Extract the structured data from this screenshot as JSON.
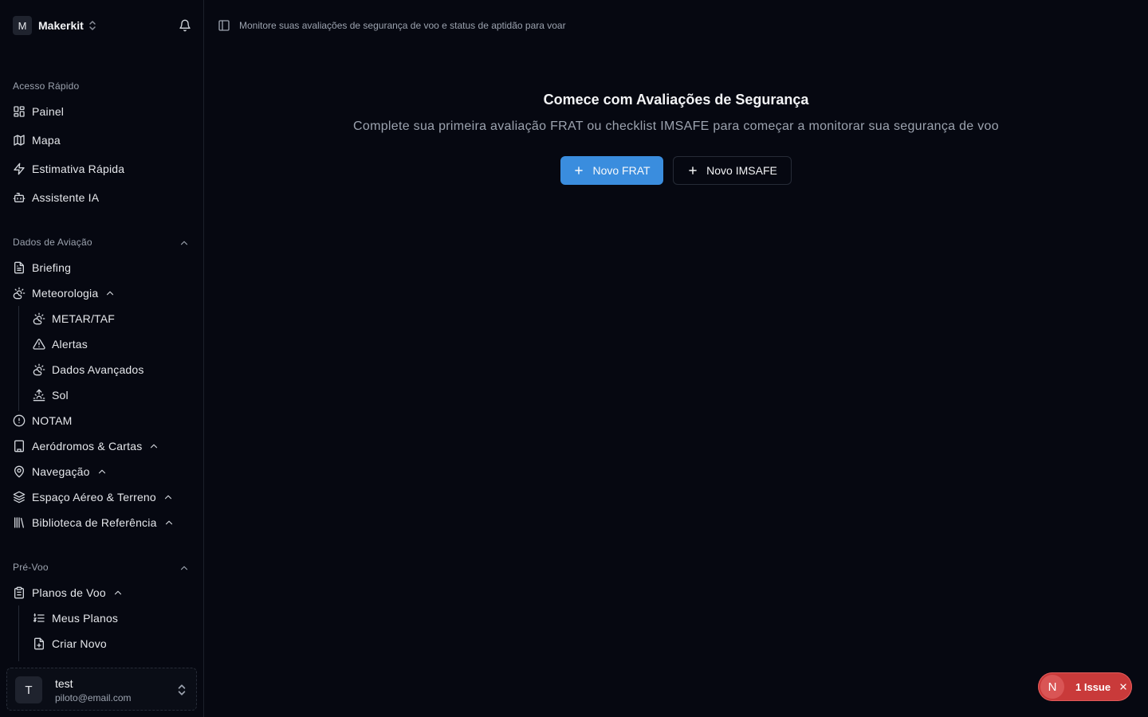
{
  "brand": {
    "initial": "M",
    "name": "Makerkit"
  },
  "sidebar": {
    "quick_access": {
      "label": "Acesso Rápido",
      "items": [
        {
          "label": "Painel",
          "icon": "dashboard-icon"
        },
        {
          "label": "Mapa",
          "icon": "map-icon"
        },
        {
          "label": "Estimativa Rápida",
          "icon": "lightning-icon"
        },
        {
          "label": "Assistente IA",
          "icon": "bot-icon"
        }
      ]
    },
    "aviation": {
      "label": "Dados de Aviação",
      "items": [
        {
          "label": "Briefing",
          "icon": "document-icon"
        },
        {
          "label": "Meteorologia",
          "icon": "cloud-sun-icon"
        },
        {
          "label": "METAR/TAF",
          "icon": "cloud-sun-icon"
        },
        {
          "label": "Alertas",
          "icon": "warning-icon"
        },
        {
          "label": "Dados Avançados",
          "icon": "cloud-sun-icon"
        },
        {
          "label": "Sol",
          "icon": "sunrise-icon"
        },
        {
          "label": "NOTAM",
          "icon": "alert-circle-icon"
        },
        {
          "label": "Aeródromos & Cartas",
          "icon": "building-icon"
        },
        {
          "label": "Navegação",
          "icon": "map-pin-icon"
        },
        {
          "label": "Espaço Aéreo & Terreno",
          "icon": "layers-icon"
        },
        {
          "label": "Biblioteca de Referência",
          "icon": "library-icon"
        }
      ]
    },
    "preflight": {
      "label": "Pré-Voo",
      "items": [
        {
          "label": "Planos de Voo",
          "icon": "clipboard-icon"
        },
        {
          "label": "Meus Planos",
          "icon": "list-icon"
        },
        {
          "label": "Criar Novo",
          "icon": "file-plus-icon"
        }
      ]
    }
  },
  "user": {
    "initial": "T",
    "name": "test",
    "email": "piloto@email.com"
  },
  "topbar": {
    "description": "Monitore suas avaliações de segurança de voo e status de aptidão para voar"
  },
  "main": {
    "title": "Comece com Avaliações de Segurança",
    "subtitle": "Complete sua primeira avaliação FRAT ou checklist IMSAFE para começar a monitorar sua segurança de voo",
    "primary_button": "Novo FRAT",
    "secondary_button": "Novo IMSAFE"
  },
  "issue_badge": {
    "letter": "N",
    "label": "1 Issue"
  },
  "colors": {
    "background": "#060811",
    "accent": "#3a8dde",
    "issue": "#c93a3a"
  }
}
